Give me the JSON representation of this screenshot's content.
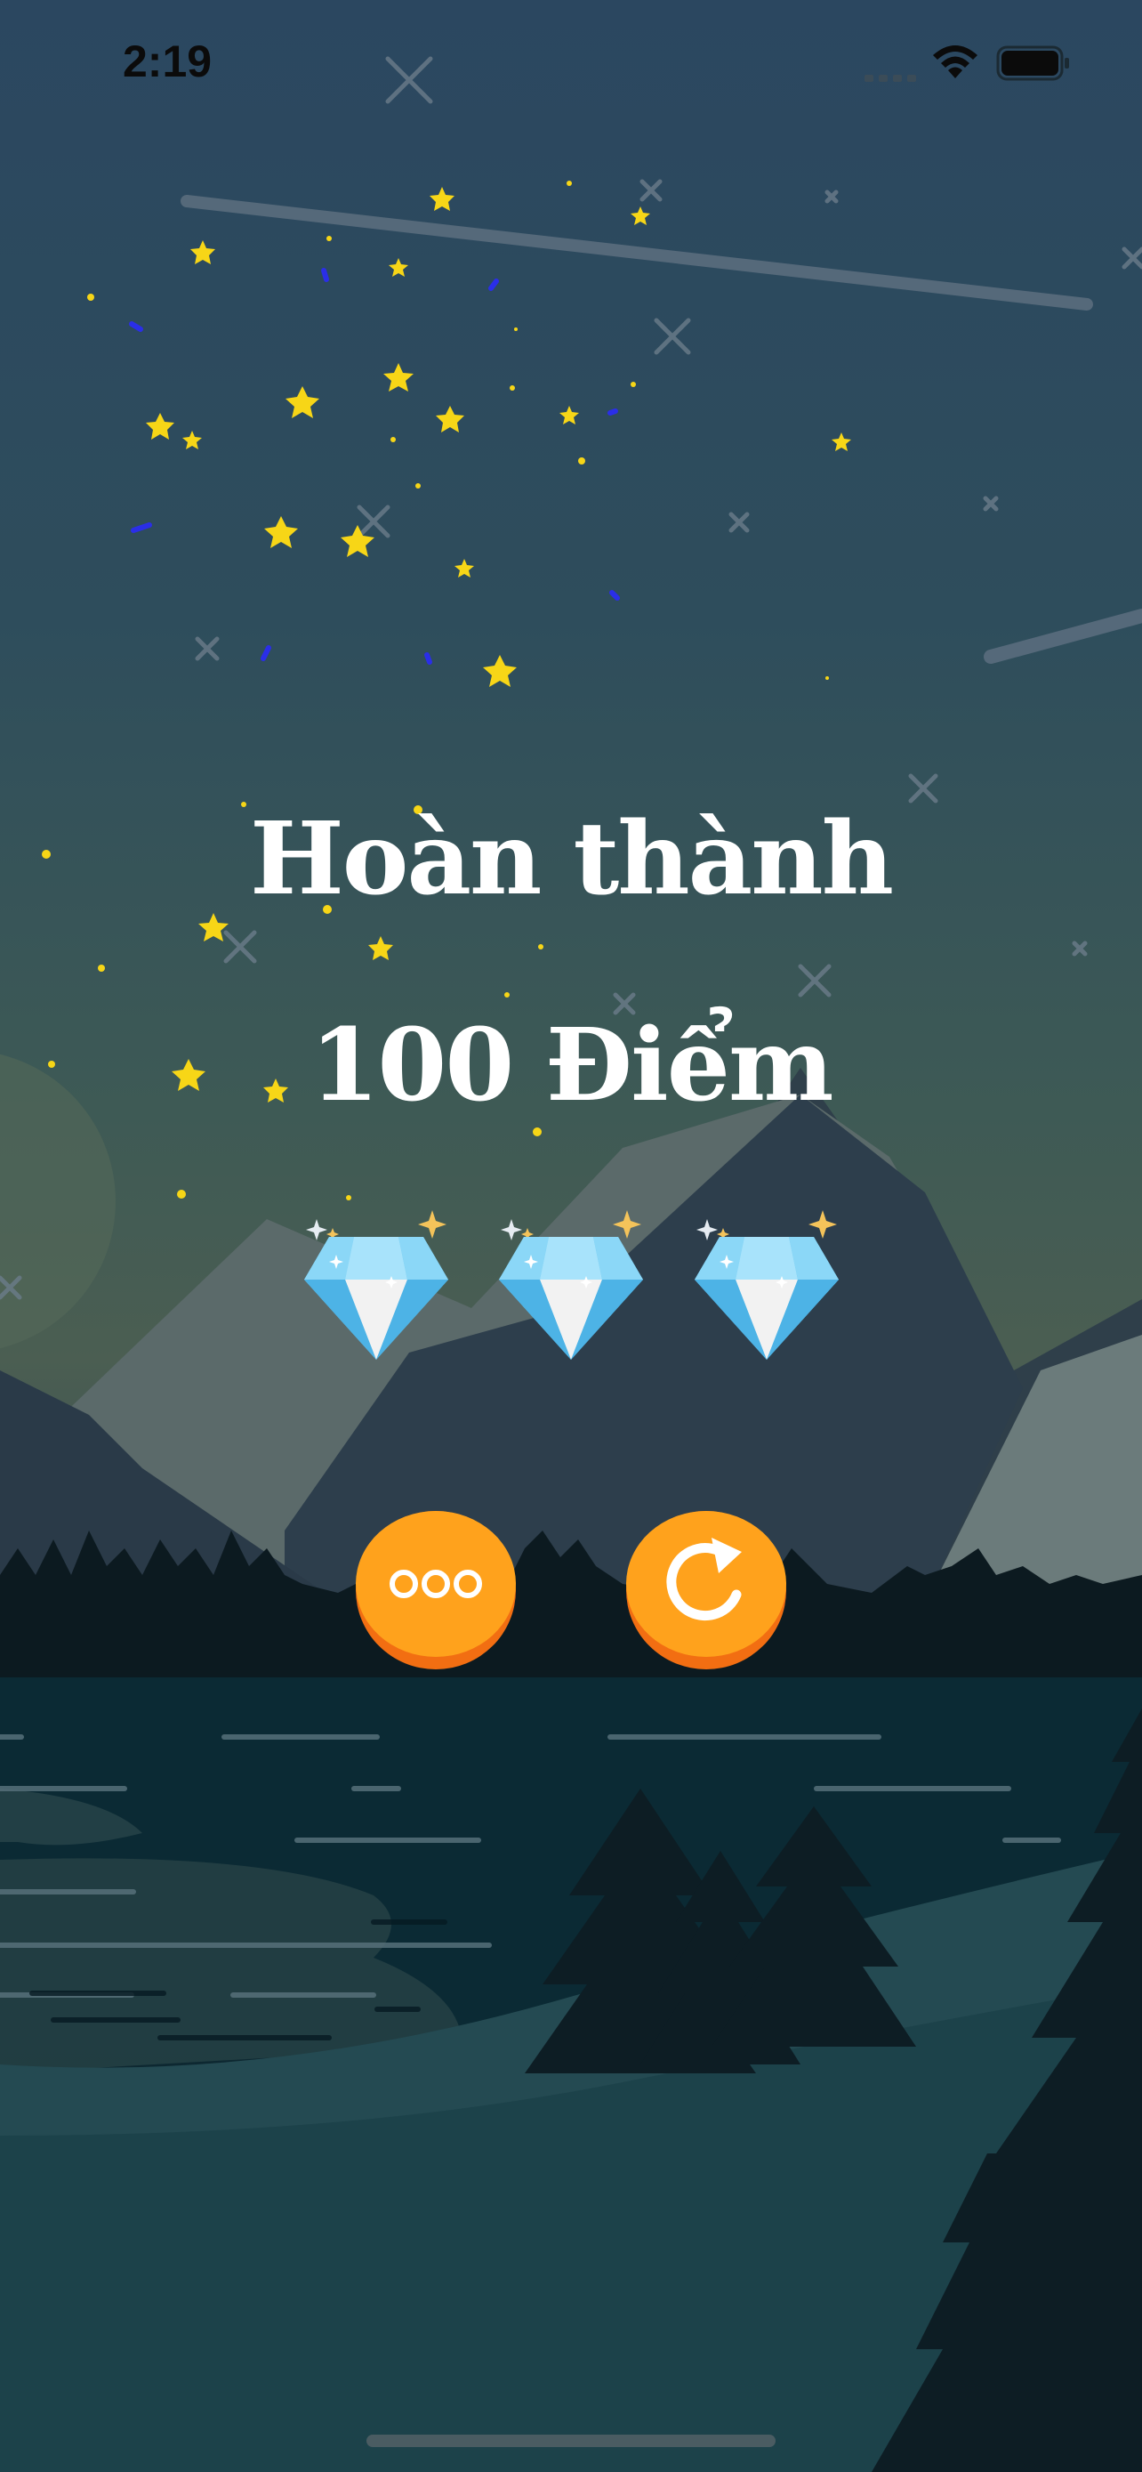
{
  "status_bar": {
    "time": "2:19"
  },
  "result": {
    "title": "Hoàn thành",
    "score": "100 Điểm",
    "gems_earned": 3,
    "gems_total": 3
  },
  "buttons": {
    "menu_icon": "more-dots-icon",
    "replay_icon": "replay-icon"
  },
  "colors": {
    "button_orange": "#ffa21c",
    "button_shadow": "#f26e12",
    "gem_blue": "#5ec2ef",
    "star_yellow": "#f7d617",
    "text": "#ffffff"
  }
}
